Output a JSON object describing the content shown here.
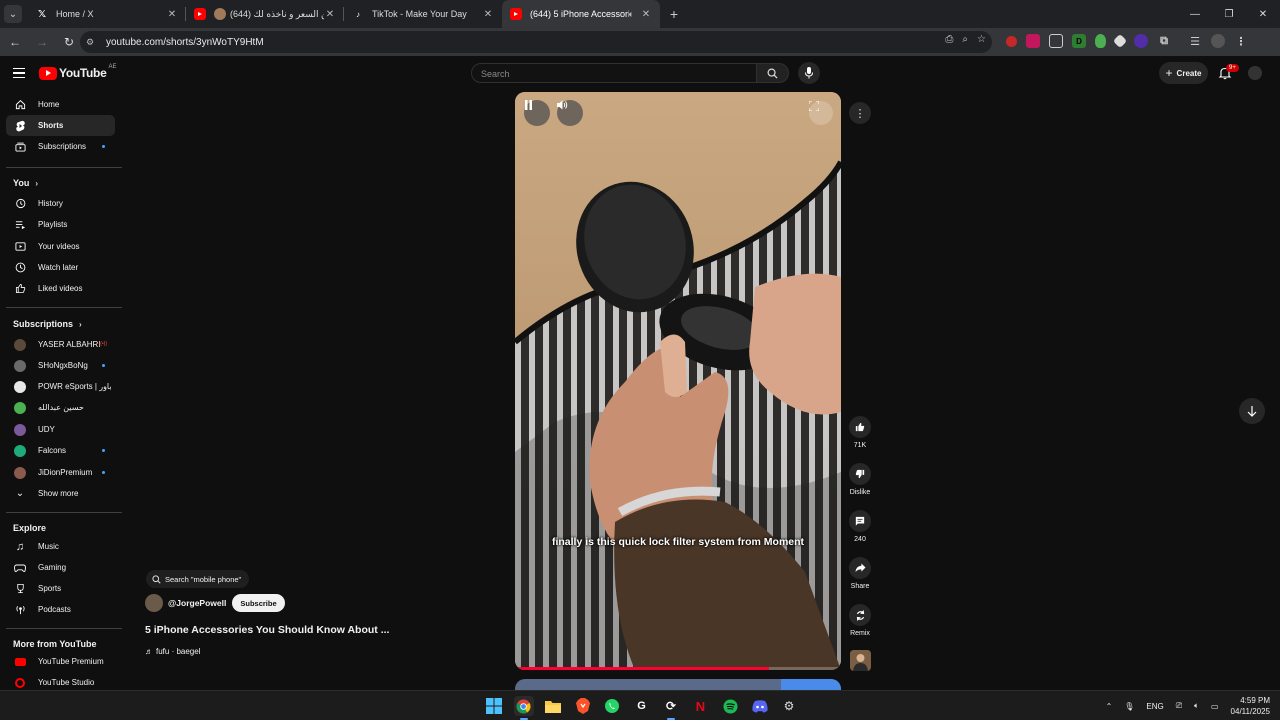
{
  "browser": {
    "tabs": [
      {
        "title": "Home / X",
        "favicon": "x-logo-icon",
        "active": false
      },
      {
        "title": "(644) حمن السعر و ناخذه لك",
        "favicon": "youtube-icon",
        "active": false
      },
      {
        "title": "TikTok - Make Your Day",
        "favicon": "tiktok-icon",
        "active": false
      },
      {
        "title": "(644) 5 iPhone Accessories",
        "favicon": "youtube-icon",
        "active": true
      }
    ],
    "url": "youtube.com/shorts/3ynWoTY9HtM",
    "new_tab_label": "+"
  },
  "youtube": {
    "logo_text": "YouTube",
    "region": "AE",
    "search_placeholder": "Search",
    "create_label": "Create",
    "notification_count": "9+"
  },
  "sidebar": {
    "main": [
      {
        "label": "Home",
        "icon": "home-icon"
      },
      {
        "label": "Shorts",
        "icon": "shorts-icon",
        "active": true
      },
      {
        "label": "Subscriptions",
        "icon": "subscriptions-icon",
        "dot": true
      }
    ],
    "you_heading": "You",
    "you_items": [
      {
        "label": "History",
        "icon": "history-icon"
      },
      {
        "label": "Playlists",
        "icon": "playlists-icon"
      },
      {
        "label": "Your videos",
        "icon": "your-videos-icon"
      },
      {
        "label": "Watch later",
        "icon": "watch-later-icon"
      },
      {
        "label": "Liked videos",
        "icon": "liked-videos-icon"
      }
    ],
    "subscriptions_heading": "Subscriptions",
    "subscriptions": [
      {
        "label": "YASER ALBAHRI",
        "color": "#5a4a3a",
        "live": true
      },
      {
        "label": "SHoNgxBoNg",
        "color": "#6a6a6a",
        "dot": true
      },
      {
        "label": "POWR eSports | باور",
        "color": "#e8e8e8"
      },
      {
        "label": "حسين عبدالله",
        "color": "#4caf50"
      },
      {
        "label": "UDY",
        "color": "#7a5a9a"
      },
      {
        "label": "Falcons",
        "color": "#1faa7a",
        "dot": true
      },
      {
        "label": "JiDionPremium",
        "color": "#8a5a4a",
        "dot": true
      }
    ],
    "show_more": "Show more",
    "explore_heading": "Explore",
    "explore": [
      {
        "label": "Music",
        "icon": "music-icon"
      },
      {
        "label": "Gaming",
        "icon": "gaming-icon"
      },
      {
        "label": "Sports",
        "icon": "sports-icon"
      },
      {
        "label": "Podcasts",
        "icon": "podcasts-icon"
      }
    ],
    "more_heading": "More from YouTube",
    "more": [
      {
        "label": "YouTube Premium",
        "icon": "youtube-premium-icon"
      },
      {
        "label": "YouTube Studio",
        "icon": "youtube-studio-icon"
      }
    ]
  },
  "short": {
    "caption": "finally is this quick lock filter system from Moment",
    "progress": 0.78,
    "search_suggestion": "Search \"mobile phone\"",
    "channel": "@JorgePowell",
    "subscribe_label": "Subscribe",
    "title": "5 iPhone Accessories You Should Know About ...",
    "audio": "fufu · baegel",
    "actions": {
      "likes": "71K",
      "dislike_label": "Dislike",
      "comments": "240",
      "share_label": "Share",
      "remix_label": "Remix"
    }
  },
  "taskbar": {
    "language": "ENG",
    "time": "4:59 PM",
    "date": "04/11/2025"
  }
}
